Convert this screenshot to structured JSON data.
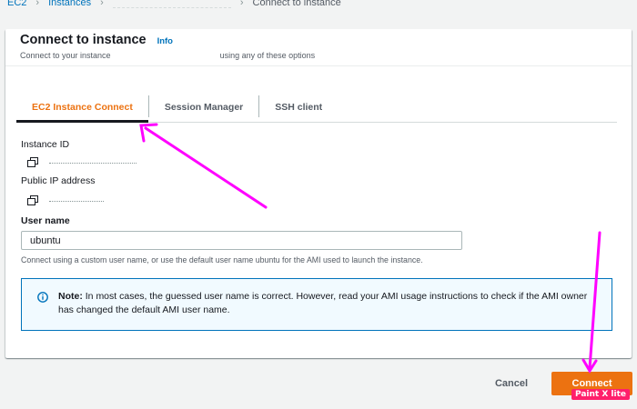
{
  "breadcrumb": {
    "items": [
      "EC2",
      "Instances",
      "Connect to instance"
    ]
  },
  "header": {
    "title": "Connect to instance",
    "info": "Info",
    "subtitle_start": "Connect to your instance",
    "subtitle_end": "using any of these options"
  },
  "tabs": [
    {
      "label": "EC2 Instance Connect",
      "active": true
    },
    {
      "label": "Session Manager",
      "active": false
    },
    {
      "label": "SSH client",
      "active": false
    }
  ],
  "fields": {
    "instance_id_label": "Instance ID",
    "public_ip_label": "Public IP address",
    "username_label": "User name",
    "username_value": "ubuntu",
    "username_hint": "Connect using a custom user name, or use the default user name ubuntu for the AMI used to launch the instance."
  },
  "note": {
    "prefix": "Note:",
    "text": "In most cases, the guessed user name is correct. However, read your AMI usage instructions to check if the AMI owner has changed the default AMI user name."
  },
  "actions": {
    "cancel": "Cancel",
    "connect": "Connect"
  },
  "watermark": "Paint X lite",
  "colors": {
    "accent": "#ec7211",
    "link": "#0073bb",
    "annotation_arrow": "#ff00ff",
    "note_bg": "#f1faff"
  }
}
